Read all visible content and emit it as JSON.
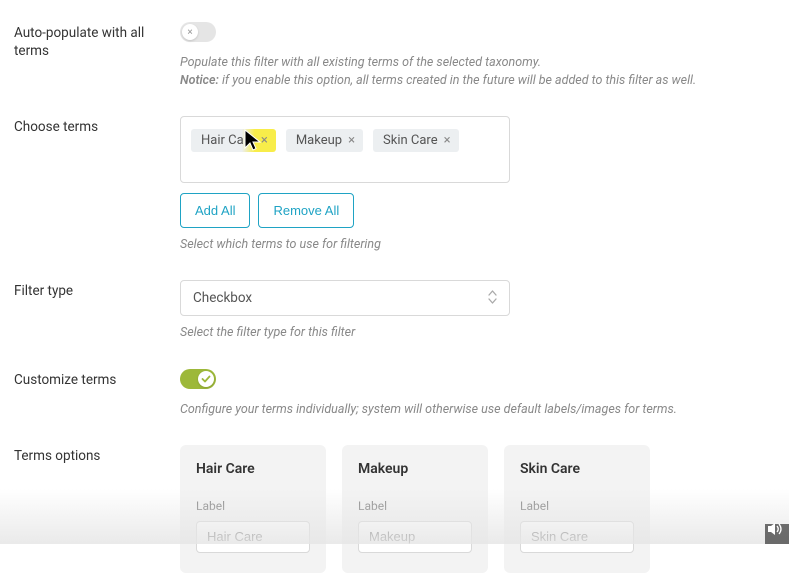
{
  "autoPopulate": {
    "label": "Auto-populate with all terms",
    "helper1": "Populate this filter with all existing terms of the selected taxonomy.",
    "noticeLabel": "Notice:",
    "helper2": " if you enable this option, all terms created in the future will be added to this filter as well."
  },
  "chooseTerms": {
    "label": "Choose terms",
    "tags": [
      {
        "label": "Hair Care"
      },
      {
        "label": "Makeup"
      },
      {
        "label": "Skin Care"
      }
    ],
    "addAll": "Add All",
    "removeAll": "Remove All",
    "helper": "Select which terms to use for filtering"
  },
  "filterType": {
    "label": "Filter type",
    "value": "Checkbox",
    "helper": "Select the filter type for this filter"
  },
  "customize": {
    "label": "Customize terms",
    "helper": "Configure your terms individually; system will otherwise use default labels/images for terms."
  },
  "termsOptions": {
    "label": "Terms options",
    "labelField": "Label",
    "cards": [
      {
        "title": "Hair Care",
        "value": "Hair Care"
      },
      {
        "title": "Makeup",
        "value": "Makeup"
      },
      {
        "title": "Skin Care",
        "value": "Skin Care"
      }
    ]
  }
}
